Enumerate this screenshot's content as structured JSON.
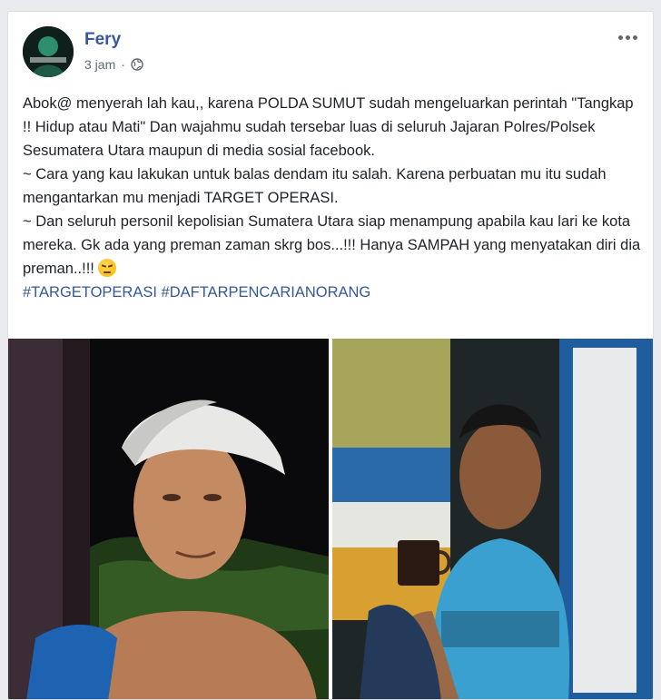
{
  "post": {
    "author": "Fery",
    "time": "3 jam",
    "separator": "·",
    "privacy_icon": "globe-icon",
    "more_icon": "more-options-icon",
    "body_lines": [
      "Abok@ menyerah lah kau,, karena POLDA SUMUT sudah mengeluarkan perintah \"Tangkap !! Hidup atau Mati\" Dan wajahmu sudah tersebar luas di seluruh Jajaran Polres/Polsek Sesumatera Utara maupun di media sosial facebook.",
      "~ Cara yang kau lakukan untuk balas dendam itu salah. Karena perbuatan mu itu sudah mengantarkan mu menjadi TARGET OPERASI.",
      "~ Dan seluruh personil kepolisian Sumatera Utara siap menampung apabila kau lari ke kota mereka. Gk ada yang preman zaman skrg bos...!!! Hanya SAMPAH yang menyatakan diri dia preman..!!!"
    ],
    "emoji": "angry-face-emoji",
    "hashtags": [
      "#TARGETOPERASI",
      "#DAFTARPENCARIANORANG"
    ],
    "photos": [
      {
        "name": "photo-man-white-cap"
      },
      {
        "name": "photo-man-blue-tank-top"
      }
    ]
  },
  "colors": {
    "author_link": "#365899",
    "body_text": "#1d2129",
    "meta_text": "#616770",
    "background": "#e9ebee"
  }
}
